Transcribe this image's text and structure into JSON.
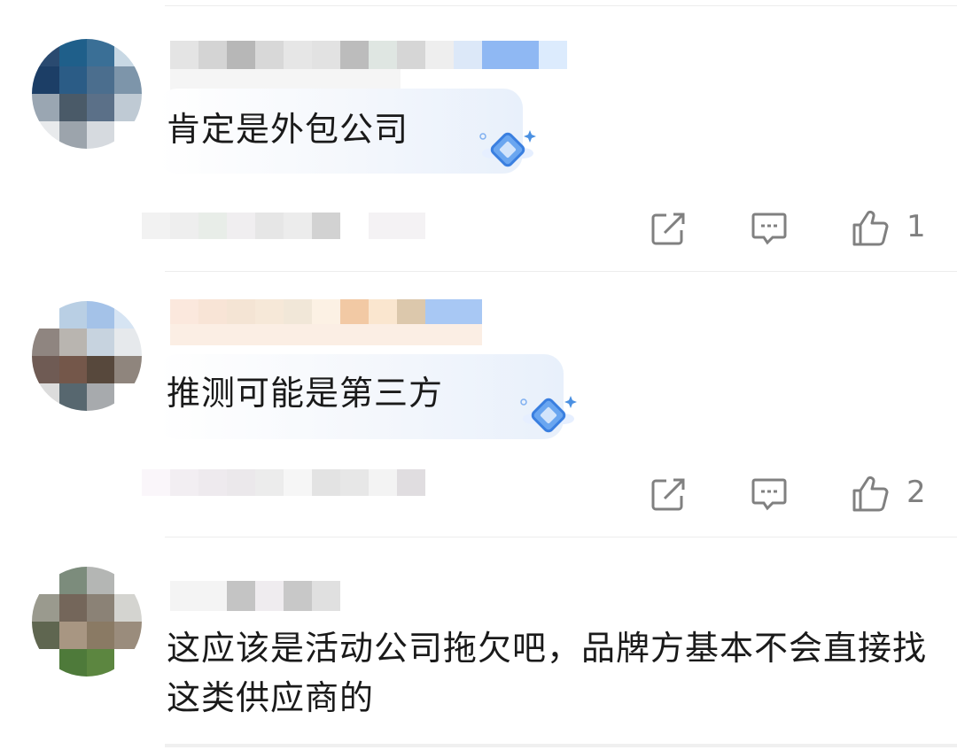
{
  "comments": [
    {
      "text": "肯定是外包公司",
      "likes": "1"
    },
    {
      "text": "推测可能是第三方",
      "likes": "2"
    },
    {
      "text": "这应该是活动公司拖欠吧，品牌方基本不会直接找这类供应商的"
    }
  ],
  "icons": {
    "reply": "reply-edit-icon",
    "comment": "comment-bubble-icon",
    "like": "thumbs-up-icon",
    "badge": "diamond-badge-icon"
  },
  "colors": {
    "text": "#1a1a1a",
    "count": "#7f7f7f",
    "icon": "#808080",
    "badge": "#4a90e2"
  }
}
